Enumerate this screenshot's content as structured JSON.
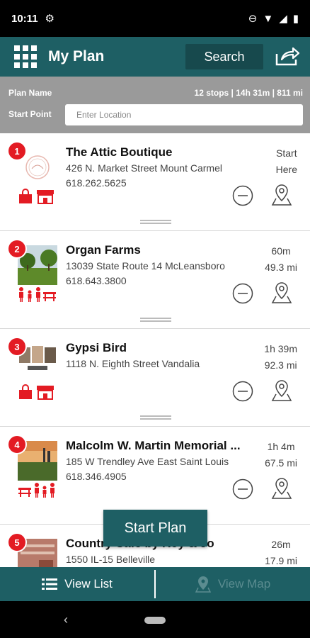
{
  "status": {
    "time": "10:11"
  },
  "header": {
    "title": "My Plan",
    "search_label": "Search"
  },
  "plan": {
    "name_label": "Plan Name",
    "summary": "12 stops | 14h 31m | 811 mi",
    "start_label": "Start Point",
    "start_placeholder": "Enter Location"
  },
  "stops": [
    {
      "num": "1",
      "name": "The Attic Boutique",
      "address": "426 N. Market Street Mount Carmel",
      "phone": "618.262.5625",
      "time": "Start",
      "distance": "Here"
    },
    {
      "num": "2",
      "name": "Organ Farms",
      "address": "13039 State Route 14 McLeansboro",
      "phone": "618.643.3800",
      "time": "60m",
      "distance": "49.3 mi"
    },
    {
      "num": "3",
      "name": "Gypsi Bird",
      "address": "1118 N. Eighth Street Vandalia",
      "phone": "",
      "time": "1h 39m",
      "distance": "92.3 mi"
    },
    {
      "num": "4",
      "name": "Malcolm W. Martin Memorial ...",
      "address": "185 W Trendley Ave East Saint Louis",
      "phone": "618.346.4905",
      "time": "1h 4m",
      "distance": "67.5 mi"
    },
    {
      "num": "5",
      "name": "Country Cafe by Roy & Jo",
      "address": "1550 IL-15 Belleville",
      "phone": "",
      "time": "26m",
      "distance": "17.9 mi"
    }
  ],
  "start_plan_label": "Start Plan",
  "tabs": {
    "list_label": "View List",
    "map_label": "View Map"
  },
  "colors": {
    "teal": "#1e5f64",
    "red": "#e31b23",
    "gray_header": "#9a9a9a"
  }
}
